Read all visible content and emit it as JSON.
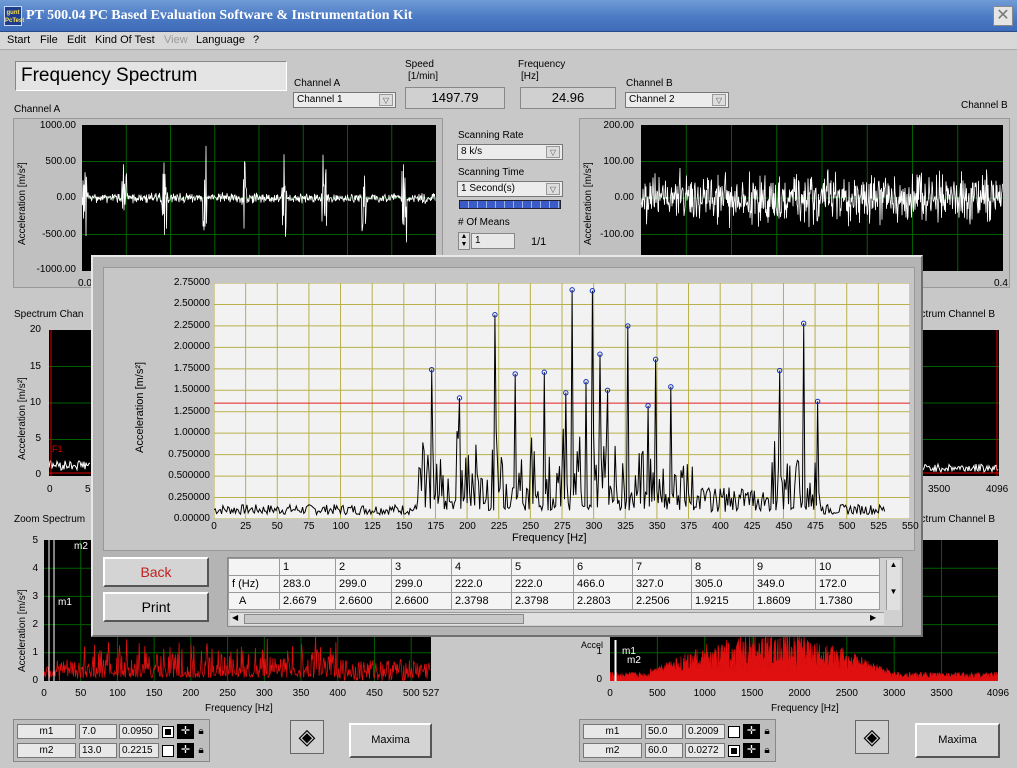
{
  "window": {
    "title": "PT 500.04 PC Based Evaluation Software & Instrumentation Kit",
    "logo_text": "gunt PcTest",
    "close": "✕"
  },
  "menu": [
    "Start",
    "File",
    "Edit",
    "Kind Of Test",
    "View",
    "Language",
    "?"
  ],
  "header": {
    "page_title": "Frequency Spectrum",
    "channel_a_label": "Channel A",
    "channel_a_value": "Channel 1",
    "speed_label": "Speed",
    "speed_unit": "[1/min]",
    "speed_value": "1497.79",
    "freq_label": "Frequency",
    "freq_unit": "[Hz]",
    "freq_value": "24.96",
    "channel_b_label": "Channel B",
    "channel_b_value": "Channel 2"
  },
  "controls": {
    "scan_rate_label": "Scanning Rate",
    "scan_rate_value": "8 k/s",
    "scan_time_label": "Scanning Time",
    "scan_time_value": "1 Second(s)",
    "means_label": "# Of Means",
    "means_value": "1",
    "means_progress": "1/1"
  },
  "scope_a": {
    "title": "Channel A",
    "ylabel": "Acceleration [m/s²]",
    "yticks": [
      "1000.00",
      "500.00",
      "0.00",
      "-500.00",
      "-1000.00"
    ],
    "x0": "0.0"
  },
  "scope_b": {
    "title": "Channel B",
    "ylabel": "Acceleration [m/s²]",
    "yticks": [
      "200.00",
      "100.00",
      "0.00",
      "-100.00"
    ],
    "x_end": "0.4"
  },
  "spectrum_a": {
    "title": "Spectrum Chan",
    "ylabel": "Acceleration [m/s²]",
    "yticks": [
      "20",
      "15",
      "10",
      "5",
      "0"
    ],
    "x0": "0",
    "x1": "5",
    "cursor": "F1"
  },
  "spectrum_b": {
    "title": "ectrum Channel B",
    "xticks": [
      "3500",
      "4096"
    ]
  },
  "zoom_a": {
    "title": "Zoom Spectrum",
    "ylabel": "Acceleration [m/s²]",
    "yticks": [
      "5",
      "4",
      "3",
      "2",
      "1",
      "0"
    ],
    "xticks": [
      "0",
      "50",
      "100",
      "150",
      "200",
      "250",
      "300",
      "350",
      "400",
      "450",
      "500",
      "527"
    ],
    "xlabel": "Frequency [Hz]",
    "m1": "m1",
    "m2": "m2"
  },
  "zoom_b": {
    "title": "ectrum Channel B",
    "ylabel": "Accel",
    "yticks": [
      "1",
      "0"
    ],
    "xticks": [
      "0",
      "500",
      "1000",
      "1500",
      "2000",
      "2500",
      "3000",
      "3500",
      "4096"
    ],
    "xlabel": "Frequency [Hz]",
    "m1": "m1",
    "m2": "m2"
  },
  "cursors_a": [
    {
      "name": "m1",
      "x": "7.0",
      "y": "0.0950"
    },
    {
      "name": "m2",
      "x": "13.0",
      "y": "0.2215"
    }
  ],
  "cursors_b": [
    {
      "name": "m1",
      "x": "50.0",
      "y": "0.2009"
    },
    {
      "name": "m2",
      "x": "60.0",
      "y": "0.0272"
    }
  ],
  "maxima_label": "Maxima",
  "popup": {
    "back_label": "Back",
    "print_label": "Print",
    "table": {
      "cols": [
        "1",
        "2",
        "3",
        "4",
        "5",
        "6",
        "7",
        "8",
        "9",
        "10"
      ],
      "row_f_label": "f  (Hz)",
      "row_a_label": "A",
      "f": [
        "283.0",
        "299.0",
        "299.0",
        "222.0",
        "222.0",
        "466.0",
        "327.0",
        "305.0",
        "349.0",
        "172.0"
      ],
      "a": [
        "2.6679",
        "2.6600",
        "2.6600",
        "2.3798",
        "2.3798",
        "2.2803",
        "2.2506",
        "1.9215",
        "1.8609",
        "1.7380"
      ]
    }
  },
  "chart_data": {
    "type": "line",
    "xlabel": "Frequency [Hz]",
    "ylabel": "Acceleration [m/s²]",
    "xlim": [
      0,
      550
    ],
    "ylim": [
      0,
      2.75
    ],
    "grid": true,
    "xticks": [
      "0",
      "25",
      "50",
      "75",
      "100",
      "125",
      "150",
      "175",
      "200",
      "225",
      "250",
      "275",
      "300",
      "325",
      "350",
      "375",
      "400",
      "425",
      "450",
      "475",
      "500",
      "525",
      "550"
    ],
    "yticks": [
      "2.75000",
      "2.50000",
      "2.25000",
      "2.00000",
      "1.75000",
      "1.50000",
      "1.25000",
      "1.00000",
      "0.750000",
      "0.500000",
      "0.250000",
      "0.00000"
    ],
    "threshold": 1.35,
    "peaks": [
      {
        "x": 172,
        "y": 1.74
      },
      {
        "x": 194,
        "y": 1.41
      },
      {
        "x": 222,
        "y": 2.38
      },
      {
        "x": 238,
        "y": 1.69
      },
      {
        "x": 261,
        "y": 1.71
      },
      {
        "x": 278,
        "y": 1.47
      },
      {
        "x": 283,
        "y": 2.67
      },
      {
        "x": 294,
        "y": 1.6
      },
      {
        "x": 299,
        "y": 2.66
      },
      {
        "x": 305,
        "y": 1.92
      },
      {
        "x": 311,
        "y": 1.5
      },
      {
        "x": 327,
        "y": 2.25
      },
      {
        "x": 343,
        "y": 1.32
      },
      {
        "x": 349,
        "y": 1.86
      },
      {
        "x": 361,
        "y": 1.54
      },
      {
        "x": 447,
        "y": 1.73
      },
      {
        "x": 466,
        "y": 2.28
      },
      {
        "x": 477,
        "y": 1.37
      }
    ]
  }
}
